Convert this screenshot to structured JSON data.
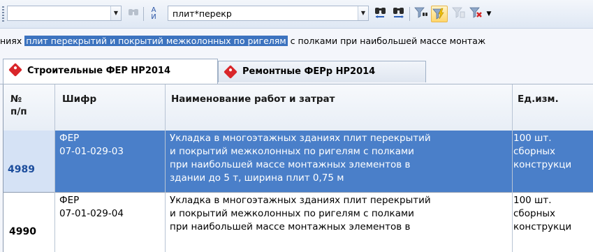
{
  "toolbar": {
    "combo_left_value": "",
    "search_value": "плит*перекр"
  },
  "context_line": {
    "before": "ниях ",
    "selected": "плит перекрытий и покрытий межколонных по ригелям",
    "after": " с полками при наибольшей массе монтаж"
  },
  "tabs": [
    {
      "label": "Строительные ФЕР НР2014",
      "active": true
    },
    {
      "label": "Ремонтные ФЕРр НР2014",
      "active": false
    }
  ],
  "columns": [
    {
      "label": "№\nп/п"
    },
    {
      "label": "Шифр"
    },
    {
      "label": "Наименование работ и затрат"
    },
    {
      "label": "Ед.изм."
    }
  ],
  "rows": [
    {
      "num": "4989",
      "code1": "ФЕР",
      "code2": "07-01-029-03",
      "name_lines": [
        "Укладка в многоэтажных зданиях плит перекрытий",
        "и покрытий межколонных по ригелям с полками",
        "при наибольшей массе монтажных элементов в",
        "здании до 5 т, ширина плит 0,75 м"
      ],
      "unit_lines": [
        "100 шт.",
        "сборных",
        "конструкци"
      ],
      "selected": true
    },
    {
      "num": "4990",
      "code1": "ФЕР",
      "code2": "07-01-029-04",
      "name_lines": [
        "Укладка в многоэтажных зданиях плит перекрытий",
        "и покрытий межколонных по ригелям с полками",
        "при наибольшей массе монтажных элементов в"
      ],
      "unit_lines": [
        "100 шт.",
        "сборных",
        "конструкци"
      ],
      "selected": false
    }
  ],
  "colors": {
    "selection": "#4a7fc9",
    "tab_tag": "#d9262a",
    "highlight_button": "#ffd66b"
  }
}
